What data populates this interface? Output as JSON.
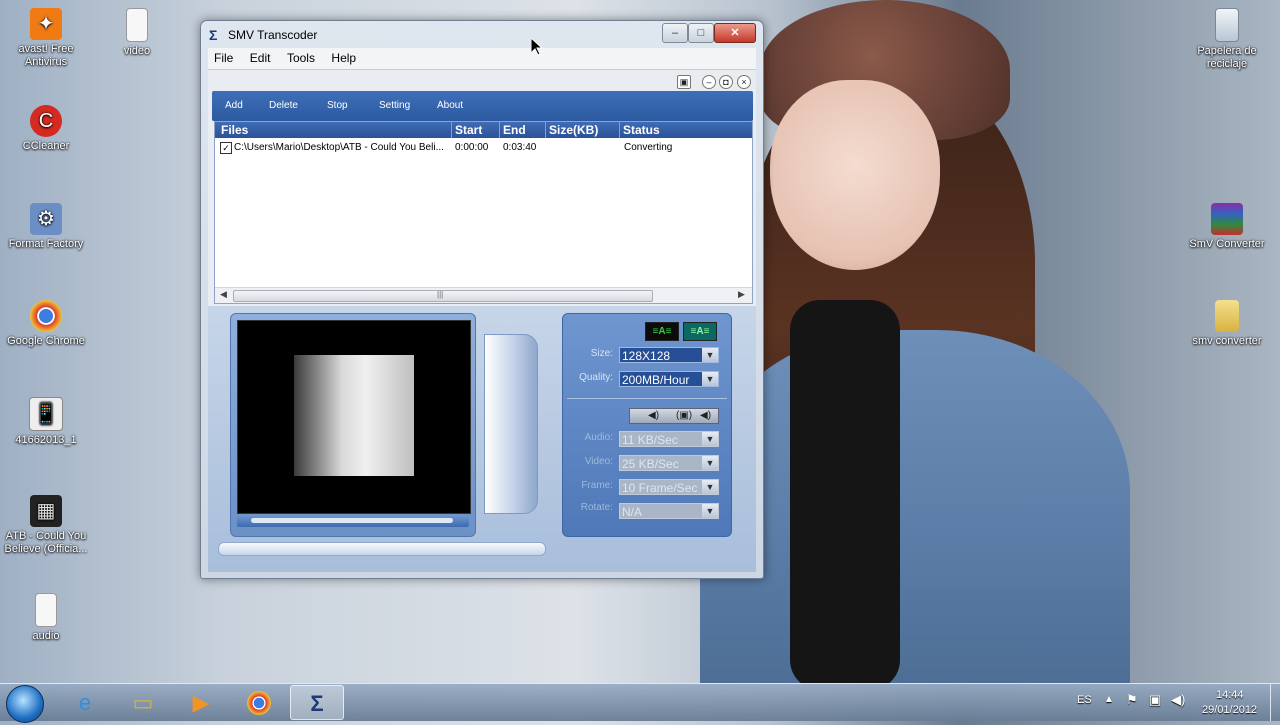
{
  "desktop": {
    "icons_left": [
      {
        "label": "avast! Free Antivirus",
        "icon": "avast-icon"
      },
      {
        "label": "video",
        "icon": "file-icon"
      },
      {
        "label": "CCleaner",
        "icon": "ccleaner-icon"
      },
      {
        "label": "Format Factory",
        "icon": "format-factory-icon"
      },
      {
        "label": "Google Chrome",
        "icon": "chrome-icon"
      },
      {
        "label": "41662013_1",
        "icon": "phone-image-icon"
      },
      {
        "label": "ATB - Could You Believe (Officia...",
        "icon": "video-file-icon"
      },
      {
        "label": "audio",
        "icon": "file-icon"
      }
    ],
    "icons_right": [
      {
        "label": "Papelera de reciclaje",
        "icon": "recycle-bin-icon"
      },
      {
        "label": "SmV Converter",
        "icon": "winrar-icon"
      },
      {
        "label": "smv converter",
        "icon": "folder-icon"
      }
    ]
  },
  "window": {
    "title": "SMV Transcoder",
    "menu": [
      "File",
      "Edit",
      "Tools",
      "Help"
    ],
    "toolbar": {
      "add": "Add",
      "delete": "Delete",
      "stop": "Stop",
      "setting": "Setting",
      "about": "About"
    },
    "list": {
      "headers": {
        "files": "Files",
        "start": "Start",
        "end": "End",
        "size": "Size(KB)",
        "status": "Status"
      },
      "rows": [
        {
          "checked": true,
          "file": "C:\\Users\\Mario\\Desktop\\ATB - Could You Beli...",
          "start": "0:00:00",
          "end": "0:03:40",
          "size": "",
          "status": "Converting"
        }
      ]
    },
    "settings": {
      "size_label": "Size:",
      "size_value": "128X128",
      "quality_label": "Quality:",
      "quality_value": "200MB/Hour",
      "audio_label": "Audio:",
      "audio_value": "11 KB/Sec",
      "video_label": "Video:",
      "video_value": "25 KB/Sec",
      "frame_label": "Frame:",
      "frame_value": "10 Frame/Sec",
      "rotate_label": "Rotate:",
      "rotate_value": "N/A"
    }
  },
  "taskbar": {
    "language": "ES",
    "time": "14:44",
    "date": "29/01/2012",
    "apps": [
      "internet-explorer-icon",
      "file-explorer-icon",
      "media-player-icon",
      "chrome-icon",
      "smv-transcoder-icon"
    ]
  }
}
